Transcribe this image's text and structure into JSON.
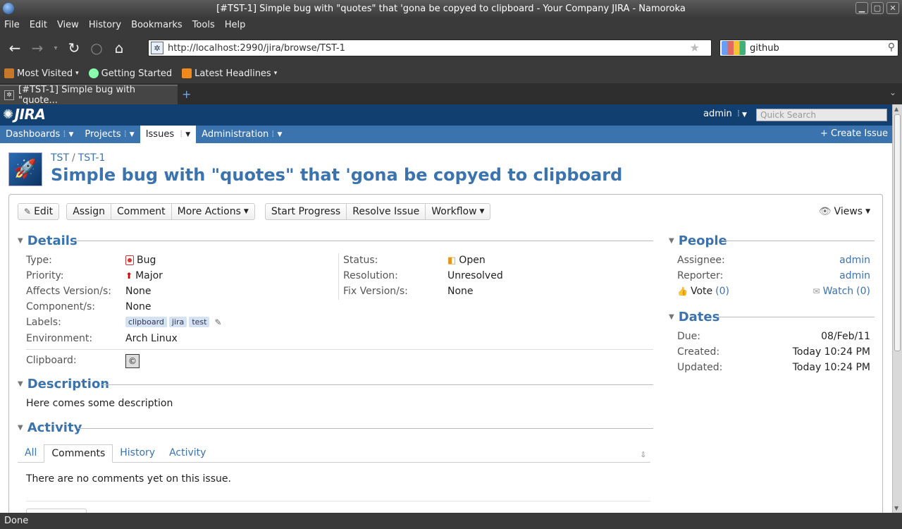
{
  "window": {
    "title": "[#TST-1] Simple bug with \"quotes\" that 'gona be copyed to clipboard - Your Company JIRA - Namoroka"
  },
  "menu": [
    "File",
    "Edit",
    "View",
    "History",
    "Bookmarks",
    "Tools",
    "Help"
  ],
  "browser": {
    "url": "http://localhost:2990/jira/browse/TST-1",
    "search_value": "github",
    "bookmarks": [
      "Most Visited",
      "Getting Started",
      "Latest Headlines"
    ],
    "tab_title": "[#TST-1] Simple bug with \"quote...",
    "status": "Done"
  },
  "jira": {
    "logo": "JIRA",
    "user": "admin",
    "quick_search_placeholder": "Quick Search",
    "nav": [
      "Dashboards",
      "Projects",
      "Issues",
      "Administration"
    ],
    "create_issue": "Create Issue"
  },
  "issue": {
    "project": "TST",
    "key": "TST-1",
    "summary": "Simple bug with \"quotes\" that 'gona be copyed to clipboard"
  },
  "toolbar": {
    "edit": "Edit",
    "assign": "Assign",
    "comment": "Comment",
    "more_actions": "More Actions",
    "start_progress": "Start Progress",
    "resolve_issue": "Resolve Issue",
    "workflow": "Workflow",
    "views": "Views"
  },
  "details": {
    "heading": "Details",
    "type_label": "Type:",
    "type_value": "Bug",
    "priority_label": "Priority:",
    "priority_value": "Major",
    "affects_label": "Affects Version/s:",
    "affects_value": "None",
    "component_label": "Component/s:",
    "component_value": "None",
    "labels_label": "Labels:",
    "labels": [
      "clipboard",
      "jira",
      "test"
    ],
    "environment_label": "Environment:",
    "environment_value": "Arch Linux",
    "status_label": "Status:",
    "status_value": "Open",
    "resolution_label": "Resolution:",
    "resolution_value": "Unresolved",
    "fix_label": "Fix Version/s:",
    "fix_value": "None",
    "clipboard_label": "Clipboard:",
    "clipboard_symbol": "©"
  },
  "description": {
    "heading": "Description",
    "text": "Here comes some description"
  },
  "activity": {
    "heading": "Activity",
    "tabs": [
      "All",
      "Comments",
      "History",
      "Activity"
    ],
    "active_tab": "Comments",
    "empty_text": "There are no comments yet on this issue."
  },
  "people": {
    "heading": "People",
    "assignee_label": "Assignee:",
    "assignee": "admin",
    "reporter_label": "Reporter:",
    "reporter": "admin",
    "vote_label": "Vote",
    "vote_count": "(0)",
    "watch_label": "Watch",
    "watch_count": "(0)"
  },
  "dates": {
    "heading": "Dates",
    "due_label": "Due:",
    "due": "08/Feb/11",
    "created_label": "Created:",
    "created": "Today 10:24 PM",
    "updated_label": "Updated:",
    "updated": "Today 10:24 PM"
  }
}
